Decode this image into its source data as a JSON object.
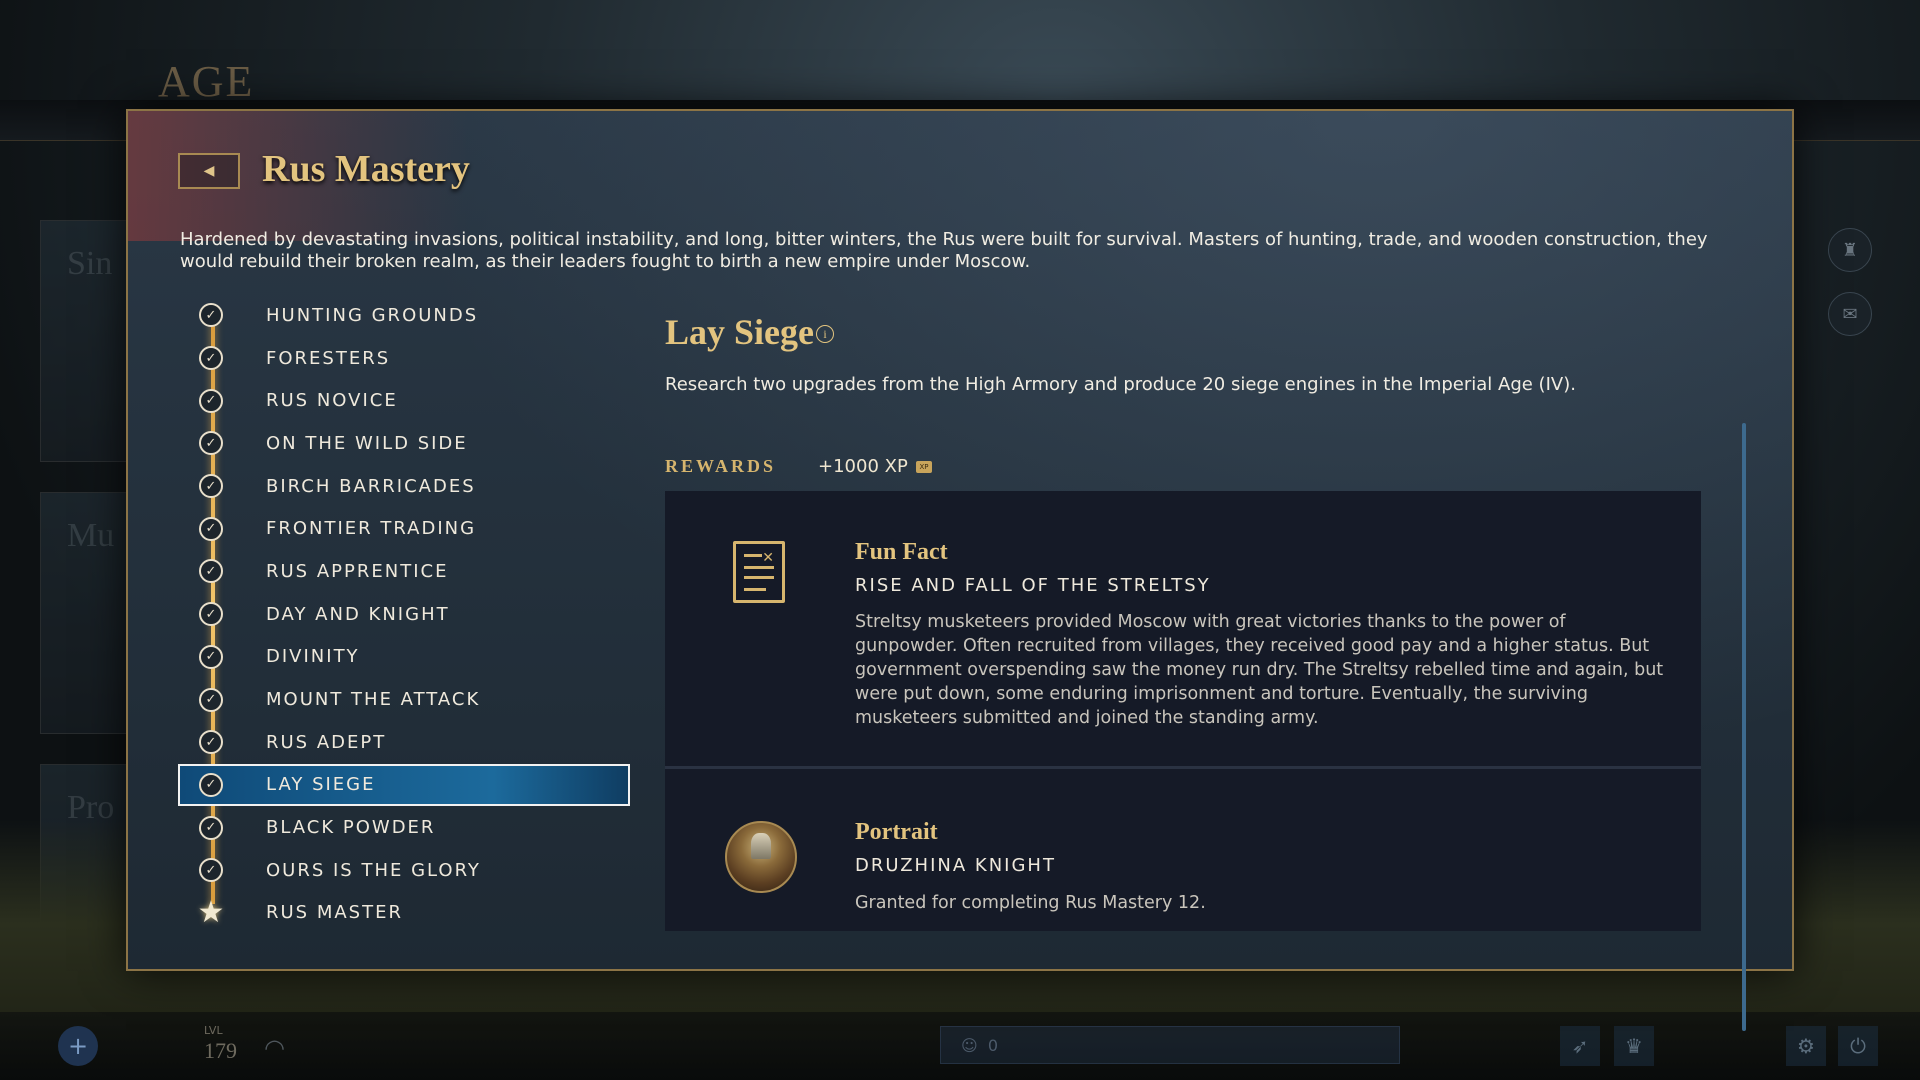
{
  "background": {
    "logo_text": "AGE",
    "side_cards": [
      "Sin",
      "Mu",
      "Pro"
    ],
    "bottom_bar": {
      "level_label": "LVL",
      "level_value": "179",
      "chat_count": "0"
    }
  },
  "modal": {
    "title": "Rus Mastery",
    "description": "Hardened by devastating invasions, political instability, and long, bitter winters, the Rus were built for survival. Masters of hunting, trade, and wooden construction, they would rebuild their broken realm, as their leaders fought to birth a new empire under Moscow.",
    "masteries": [
      {
        "label": "HUNTING GROUNDS",
        "completed": true
      },
      {
        "label": "FORESTERS",
        "completed": true
      },
      {
        "label": "RUS NOVICE",
        "completed": true
      },
      {
        "label": "ON THE WILD SIDE",
        "completed": true
      },
      {
        "label": "BIRCH BARRICADES",
        "completed": true
      },
      {
        "label": "FRONTIER TRADING",
        "completed": true
      },
      {
        "label": "RUS APPRENTICE",
        "completed": true
      },
      {
        "label": "DAY AND KNIGHT",
        "completed": true
      },
      {
        "label": "DIVINITY",
        "completed": true
      },
      {
        "label": "MOUNT THE ATTACK",
        "completed": true
      },
      {
        "label": "RUS ADEPT",
        "completed": true
      },
      {
        "label": "LAY SIEGE",
        "completed": true,
        "selected": true
      },
      {
        "label": "BLACK POWDER",
        "completed": true
      },
      {
        "label": "OURS IS THE GLORY",
        "completed": true
      },
      {
        "label": "RUS MASTER",
        "completed": true,
        "final": true
      }
    ],
    "detail": {
      "title": "Lay Siege",
      "info_glyph": "i",
      "description": "Research two upgrades from the High Armory and produce 20 siege engines in the Imperial Age (IV).",
      "rewards_label": "REWARDS",
      "xp": "+1000 XP",
      "xp_badge": "XP",
      "rewards": [
        {
          "type": "fun-fact",
          "title": "Fun Fact",
          "subtitle": "RISE AND FALL OF THE STRELTSY",
          "body": "Streltsy musketeers provided Moscow with great victories thanks to the power of gunpowder. Often recruited from villages, they received good pay and a higher status. But government overspending saw the money run dry. The Streltsy rebelled time and again, but were put down, some enduring imprisonment and torture. Eventually, the surviving musketeers submitted and joined the standing army.",
          "icon": "document-icon"
        },
        {
          "type": "portrait",
          "title": "Portrait",
          "subtitle": "DRUZHINA KNIGHT",
          "body": "Granted for completing Rus Mastery 12.",
          "icon": "knight-portrait"
        }
      ]
    }
  },
  "colors": {
    "gold": "#e3c47f",
    "selected_bg": "#1c6a9c",
    "modal_border": "#8c7446"
  }
}
